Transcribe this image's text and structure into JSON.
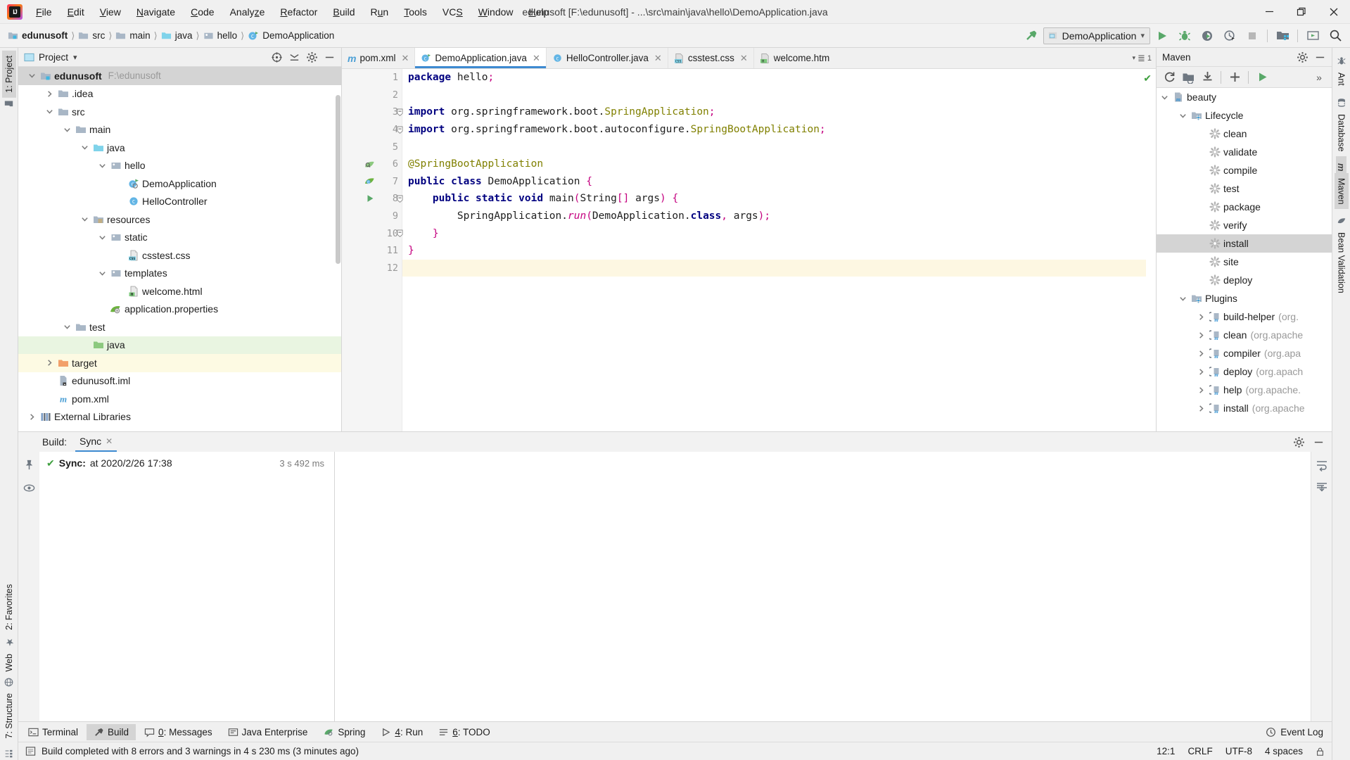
{
  "window": {
    "title": "edunusoft [F:\\edunusoft] - ...\\src\\main\\java\\hello\\DemoApplication.java",
    "minimize": "—",
    "maximize": "❐",
    "close": "✕"
  },
  "menu": [
    "File",
    "Edit",
    "View",
    "Navigate",
    "Code",
    "Analyze",
    "Refactor",
    "Build",
    "Run",
    "Tools",
    "VCS",
    "Window",
    "Help"
  ],
  "breadcrumb": [
    {
      "label": "edunusoft",
      "icon": "module-icon",
      "bold": true
    },
    {
      "label": "src",
      "icon": "folder-icon",
      "bold": false
    },
    {
      "label": "main",
      "icon": "folder-icon",
      "bold": false
    },
    {
      "label": "java",
      "icon": "source-folder-icon",
      "bold": false
    },
    {
      "label": "hello",
      "icon": "package-icon",
      "bold": false
    },
    {
      "label": "DemoApplication",
      "icon": "class-run-icon",
      "bold": false
    }
  ],
  "toolbar": {
    "run_config": "DemoApplication",
    "buttons": [
      "run-button",
      "debug-button",
      "run-with-coverage-button",
      "profile-button",
      "stop-button",
      "project-structure-button",
      "open-in-browser-button",
      "search-everywhere-button"
    ]
  },
  "project_panel": {
    "title": "Project",
    "tree": [
      {
        "label": "edunusoft",
        "path": "F:\\edunusoft",
        "depth": 0,
        "arrow": "down",
        "icon": "module-icon",
        "bold": true,
        "state": "sel"
      },
      {
        "label": ".idea",
        "path": "",
        "depth": 1,
        "arrow": "right",
        "icon": "folder-icon",
        "bold": false,
        "state": ""
      },
      {
        "label": "src",
        "path": "",
        "depth": 1,
        "arrow": "down",
        "icon": "folder-icon",
        "bold": false,
        "state": ""
      },
      {
        "label": "main",
        "path": "",
        "depth": 2,
        "arrow": "down",
        "icon": "folder-icon",
        "bold": false,
        "state": ""
      },
      {
        "label": "java",
        "path": "",
        "depth": 3,
        "arrow": "down",
        "icon": "source-folder-icon",
        "bold": false,
        "state": ""
      },
      {
        "label": "hello",
        "path": "",
        "depth": 4,
        "arrow": "down",
        "icon": "package-icon",
        "bold": false,
        "state": ""
      },
      {
        "label": "DemoApplication",
        "path": "",
        "depth": 5,
        "arrow": "none",
        "icon": "class-run-icon",
        "bold": false,
        "state": ""
      },
      {
        "label": "HelloController",
        "path": "",
        "depth": 5,
        "arrow": "none",
        "icon": "class-icon",
        "bold": false,
        "state": ""
      },
      {
        "label": "resources",
        "path": "",
        "depth": 3,
        "arrow": "down",
        "icon": "resources-folder-icon",
        "bold": false,
        "state": ""
      },
      {
        "label": "static",
        "path": "",
        "depth": 4,
        "arrow": "down",
        "icon": "package-icon",
        "bold": false,
        "state": ""
      },
      {
        "label": "csstest.css",
        "path": "",
        "depth": 5,
        "arrow": "none",
        "icon": "css-file-icon",
        "bold": false,
        "state": ""
      },
      {
        "label": "templates",
        "path": "",
        "depth": 4,
        "arrow": "down",
        "icon": "package-icon",
        "bold": false,
        "state": ""
      },
      {
        "label": "welcome.html",
        "path": "",
        "depth": 5,
        "arrow": "none",
        "icon": "html-file-icon",
        "bold": false,
        "state": ""
      },
      {
        "label": "application.properties",
        "path": "",
        "depth": 4,
        "arrow": "none",
        "icon": "spring-properties-icon",
        "bold": false,
        "state": ""
      },
      {
        "label": "test",
        "path": "",
        "depth": 2,
        "arrow": "down",
        "icon": "folder-icon",
        "bold": false,
        "state": ""
      },
      {
        "label": "java",
        "path": "",
        "depth": 3,
        "arrow": "none",
        "icon": "test-source-folder-icon",
        "bold": false,
        "state": "green"
      },
      {
        "label": "target",
        "path": "",
        "depth": 1,
        "arrow": "right",
        "icon": "excluded-folder-icon",
        "bold": false,
        "state": "yellow"
      },
      {
        "label": "edunusoft.iml",
        "path": "",
        "depth": 1,
        "arrow": "none",
        "icon": "iml-file-icon",
        "bold": false,
        "state": ""
      },
      {
        "label": "pom.xml",
        "path": "",
        "depth": 1,
        "arrow": "none",
        "icon": "maven-file-icon",
        "bold": false,
        "state": ""
      },
      {
        "label": "External Libraries",
        "path": "",
        "depth": 0,
        "arrow": "right",
        "icon": "libraries-icon",
        "bold": false,
        "state": ""
      }
    ]
  },
  "editor": {
    "tabs": [
      {
        "label": "pom.xml",
        "icon": "maven-file-icon",
        "active": false
      },
      {
        "label": "DemoApplication.java",
        "icon": "class-run-icon",
        "active": true
      },
      {
        "label": "HelloController.java",
        "icon": "class-icon",
        "active": false
      },
      {
        "label": "csstest.css",
        "icon": "css-file-icon",
        "active": false
      },
      {
        "label": "welcome.htm",
        "icon": "html-file-icon",
        "active": false
      }
    ],
    "tabs_overflow": "1",
    "inspection_status": "ok-check-icon",
    "lines": [
      {
        "n": "1",
        "marker": "",
        "text": "package hello;"
      },
      {
        "n": "2",
        "marker": "",
        "text": ""
      },
      {
        "n": "3",
        "marker": "",
        "text": "import org.springframework.boot.SpringApplication;"
      },
      {
        "n": "4",
        "marker": "",
        "text": "import org.springframework.boot.autoconfigure.SpringBootApplication;"
      },
      {
        "n": "5",
        "marker": "",
        "text": ""
      },
      {
        "n": "6",
        "marker": "spring-bean-icon",
        "text": "@SpringBootApplication"
      },
      {
        "n": "7",
        "marker": "spring-run-icon",
        "text": "public class DemoApplication {"
      },
      {
        "n": "8",
        "marker": "run-gutter-icon",
        "text": "    public static void main(String[] args) {"
      },
      {
        "n": "9",
        "marker": "",
        "text": "        SpringApplication.run(DemoApplication.class, args);"
      },
      {
        "n": "10",
        "marker": "",
        "text": "    }"
      },
      {
        "n": "11",
        "marker": "",
        "text": "}"
      },
      {
        "n": "12",
        "marker": "",
        "text": ""
      }
    ]
  },
  "maven_panel": {
    "title": "Maven",
    "toolbar": [
      "reload-icon",
      "add-maven-project-icon",
      "download-sources-icon",
      "plus-icon",
      "execute-goal-icon",
      "more-icon"
    ],
    "tree": [
      {
        "label": "beauty",
        "sub": "",
        "depth": 0,
        "arrow": "down",
        "icon": "maven-project-icon",
        "state": ""
      },
      {
        "label": "Lifecycle",
        "sub": "",
        "depth": 1,
        "arrow": "down",
        "icon": "phase-folder-icon",
        "state": ""
      },
      {
        "label": "clean",
        "sub": "",
        "depth": 2,
        "arrow": "none",
        "icon": "goal-icon",
        "state": ""
      },
      {
        "label": "validate",
        "sub": "",
        "depth": 2,
        "arrow": "none",
        "icon": "goal-icon",
        "state": ""
      },
      {
        "label": "compile",
        "sub": "",
        "depth": 2,
        "arrow": "none",
        "icon": "goal-icon",
        "state": ""
      },
      {
        "label": "test",
        "sub": "",
        "depth": 2,
        "arrow": "none",
        "icon": "goal-icon",
        "state": ""
      },
      {
        "label": "package",
        "sub": "",
        "depth": 2,
        "arrow": "none",
        "icon": "goal-icon",
        "state": ""
      },
      {
        "label": "verify",
        "sub": "",
        "depth": 2,
        "arrow": "none",
        "icon": "goal-icon",
        "state": ""
      },
      {
        "label": "install",
        "sub": "",
        "depth": 2,
        "arrow": "none",
        "icon": "goal-icon",
        "state": "sel"
      },
      {
        "label": "site",
        "sub": "",
        "depth": 2,
        "arrow": "none",
        "icon": "goal-icon",
        "state": ""
      },
      {
        "label": "deploy",
        "sub": "",
        "depth": 2,
        "arrow": "none",
        "icon": "goal-icon",
        "state": ""
      },
      {
        "label": "Plugins",
        "sub": "",
        "depth": 1,
        "arrow": "down",
        "icon": "phase-folder-icon",
        "state": ""
      },
      {
        "label": "build-helper",
        "sub": "(org.",
        "depth": 2,
        "arrow": "right",
        "icon": "plugin-icon",
        "state": ""
      },
      {
        "label": "clean",
        "sub": "(org.apache",
        "depth": 2,
        "arrow": "right",
        "icon": "plugin-icon",
        "state": ""
      },
      {
        "label": "compiler",
        "sub": "(org.apa",
        "depth": 2,
        "arrow": "right",
        "icon": "plugin-icon",
        "state": ""
      },
      {
        "label": "deploy",
        "sub": "(org.apach",
        "depth": 2,
        "arrow": "right",
        "icon": "plugin-icon",
        "state": ""
      },
      {
        "label": "help",
        "sub": "(org.apache.",
        "depth": 2,
        "arrow": "right",
        "icon": "plugin-icon",
        "state": ""
      },
      {
        "label": "install",
        "sub": "(org.apache",
        "depth": 2,
        "arrow": "right",
        "icon": "plugin-icon",
        "state": ""
      }
    ]
  },
  "build_panel": {
    "label": "Build:",
    "tab": "Sync",
    "sync_prefix": "Sync:",
    "sync_detail": "at 2020/2/26 17:38",
    "duration": "3 s 492 ms"
  },
  "bottom_tabs": [
    {
      "num": "",
      "label": "Terminal",
      "icon": "terminal-icon",
      "active": false
    },
    {
      "num": "",
      "label": "Build",
      "icon": "build-hammer-icon",
      "active": true
    },
    {
      "num": "0",
      "label": "Messages",
      "icon": "messages-icon",
      "active": false
    },
    {
      "num": "",
      "label": "Java Enterprise",
      "icon": "java-ee-icon",
      "active": false
    },
    {
      "num": "",
      "label": "Spring",
      "icon": "spring-leaf-icon",
      "active": false
    },
    {
      "num": "4",
      "label": "Run",
      "icon": "run-play-icon",
      "active": false
    },
    {
      "num": "6",
      "label": "TODO",
      "icon": "todo-icon",
      "active": false
    }
  ],
  "event_log": "Event Log",
  "left_rail": [
    {
      "label": "1: Project",
      "active": true,
      "icon": "project-icon"
    },
    {
      "label": "2: Favorites",
      "active": false,
      "icon": "star-icon"
    },
    {
      "label": "Web",
      "active": false,
      "icon": "web-icon"
    },
    {
      "label": "7: Structure",
      "active": false,
      "icon": "structure-icon"
    }
  ],
  "right_rail": [
    {
      "label": "Ant",
      "active": false,
      "icon": "ant-icon"
    },
    {
      "label": "Database",
      "active": false,
      "icon": "database-icon"
    },
    {
      "label": "Maven",
      "active": true,
      "icon": "maven-m-icon"
    },
    {
      "label": "Bean Validation",
      "active": false,
      "icon": "bean-icon"
    }
  ],
  "status_bar": {
    "message": "Build completed with 8 errors and 3 warnings in 4 s 230 ms (3 minutes ago)",
    "caret": "12:1",
    "line_sep": "CRLF",
    "encoding": "UTF-8",
    "indent": "4 spaces",
    "icon": "build-status-icon"
  },
  "colors": {
    "accent": "#3d8ad1",
    "green": "#59a869",
    "selected_row": "#d4d4d4",
    "test_source": "#e9f5e1",
    "excluded": "#fdfae3",
    "keyword": "#000080",
    "annotation": "#808000",
    "pink": "#c4007f"
  }
}
